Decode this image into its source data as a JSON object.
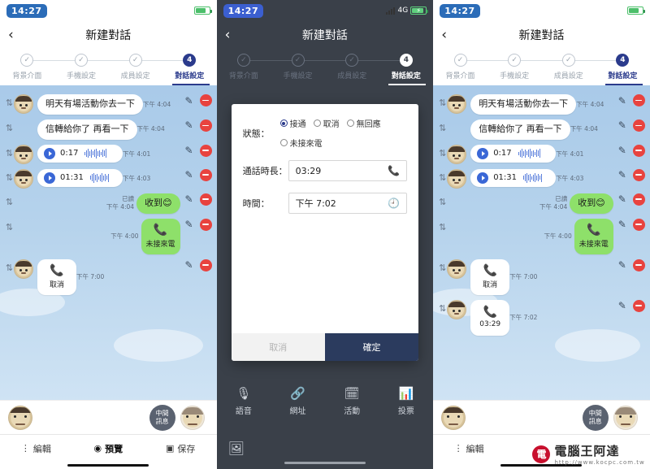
{
  "screens": [
    {
      "id": "left",
      "status": {
        "time": "14:27",
        "battery_pct": 78,
        "signal": "",
        "network": ""
      },
      "header": {
        "back": "‹",
        "title": "新建對話"
      },
      "steps": [
        {
          "label": "背景介面",
          "num": "1",
          "active": false
        },
        {
          "label": "手機設定",
          "num": "2",
          "active": false
        },
        {
          "label": "成員設定",
          "num": "3",
          "active": false
        },
        {
          "label": "對話設定",
          "num": "4",
          "active": true
        }
      ],
      "messages": [
        {
          "kind": "text",
          "side": "left",
          "text": "明天有場活動你去一下",
          "time": "下午 4:04"
        },
        {
          "kind": "text",
          "side": "left",
          "text": "信轉給你了 再看一下",
          "time": "下午 4:04"
        },
        {
          "kind": "voice",
          "side": "left",
          "duration": "0:17",
          "time": "下午 4:01"
        },
        {
          "kind": "voice",
          "side": "left",
          "duration": "01:31",
          "time": "下午 4:03"
        },
        {
          "kind": "text",
          "side": "right",
          "text": "收到",
          "meta": "已讀\n下午 4:04",
          "emoji": "😊"
        },
        {
          "kind": "call",
          "side": "right",
          "label": "未接來電",
          "time": "下午 4:00",
          "green": true
        },
        {
          "kind": "call",
          "side": "left",
          "label": "取消",
          "time": "下午 7:00",
          "green": false
        }
      ],
      "bottom": {
        "mid_button": "中間\n訊息",
        "tabs": [
          {
            "label": "編輯",
            "icon": "dots-icon",
            "active": false
          },
          {
            "label": "預覽",
            "icon": "eye-icon",
            "active": true
          },
          {
            "label": "保存",
            "icon": "save-icon",
            "active": false
          }
        ]
      }
    },
    {
      "id": "middle",
      "status": {
        "time": "14:27",
        "network": "4G",
        "battery_pct": 85
      },
      "header": {
        "back": "‹",
        "title": "新建對話"
      },
      "steps": [
        {
          "label": "背景介面",
          "num": "1",
          "active": false
        },
        {
          "label": "手機設定",
          "num": "2",
          "active": false
        },
        {
          "label": "成員設定",
          "num": "3",
          "active": false
        },
        {
          "label": "對話設定",
          "num": "4",
          "active": true
        }
      ],
      "dialog": {
        "state_label": "狀態：",
        "options": [
          {
            "label": "接通",
            "selected": true
          },
          {
            "label": "取消",
            "selected": false
          },
          {
            "label": "無回應",
            "selected": false
          },
          {
            "label": "未接來電",
            "selected": false
          }
        ],
        "duration_label": "通話時長：",
        "duration_value": "03:29",
        "duration_icon": "phone-icon",
        "time_label": "時間：",
        "time_value": "下午 7:02",
        "time_icon": "clock-icon",
        "cancel": "取消",
        "confirm": "確定"
      },
      "toolbar": [
        {
          "label": "語音",
          "icon": "mic-icon"
        },
        {
          "label": "網址",
          "icon": "link-icon"
        },
        {
          "label": "活動",
          "icon": "calendar-icon"
        },
        {
          "label": "投票",
          "icon": "poll-icon"
        }
      ],
      "bottom_icon": "image-icon"
    },
    {
      "id": "right",
      "status": {
        "time": "14:27",
        "battery_pct": 78
      },
      "header": {
        "back": "‹",
        "title": "新建對話"
      },
      "steps": [
        {
          "label": "背景介面",
          "num": "1",
          "active": false
        },
        {
          "label": "手機設定",
          "num": "2",
          "active": false
        },
        {
          "label": "成員設定",
          "num": "3",
          "active": false
        },
        {
          "label": "對話設定",
          "num": "4",
          "active": true
        }
      ],
      "messages": [
        {
          "kind": "text",
          "side": "left",
          "text": "明天有場活動你去一下",
          "time": "下午 4:04"
        },
        {
          "kind": "text",
          "side": "left",
          "text": "信轉給你了 再看一下",
          "time": "下午 4:04"
        },
        {
          "kind": "voice",
          "side": "left",
          "duration": "0:17",
          "time": "下午 4:01"
        },
        {
          "kind": "voice",
          "side": "left",
          "duration": "01:31",
          "time": "下午 4:03"
        },
        {
          "kind": "text",
          "side": "right",
          "text": "收到",
          "meta": "已讀\n下午 4:04",
          "emoji": "😊"
        },
        {
          "kind": "call",
          "side": "right",
          "label": "未接來電",
          "time": "下午 4:00",
          "green": true
        },
        {
          "kind": "call",
          "side": "left",
          "label": "取消",
          "time": "下午 7:00",
          "green": false
        },
        {
          "kind": "call",
          "side": "left",
          "label": "03:29",
          "time": "下午 7:02",
          "green": false
        }
      ],
      "bottom": {
        "mid_button": "中間\n訊息",
        "tabs": [
          {
            "label": "編輯",
            "icon": "dots-icon",
            "active": false
          }
        ]
      }
    }
  ],
  "watermark": {
    "logo": "電",
    "text": "電腦王阿達",
    "sub": "http://www.kocpc.com.tw"
  }
}
